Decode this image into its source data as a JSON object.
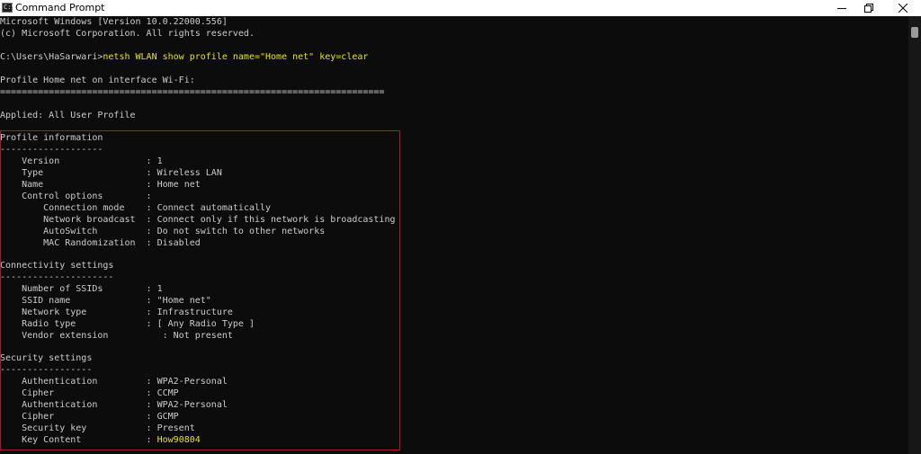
{
  "window": {
    "title": "Command Prompt",
    "app_icon": "C:\\",
    "icon_names": [
      "terminal-icon",
      "minimize-icon",
      "maximize-icon",
      "close-icon"
    ]
  },
  "colors": {
    "terminal_bg": "#0c0c0c",
    "terminal_text": "#cccccc",
    "highlight": "#e5e510",
    "box_border": "#b2162a"
  },
  "console": {
    "l1": "Microsoft Windows [Version 10.0.22000.556]",
    "l2": "(c) Microsoft Corporation. All rights reserved.",
    "prompt": "C:\\Users\\HaSarwari>",
    "command": "netsh WLAN show profile name=\"Home net\" key=clear",
    "l4": "Profile Home net on interface Wi-Fi:",
    "l5": "=======================================================================",
    "l6": "Applied: All User Profile",
    "profile": {
      "header": "Profile information",
      "underline": "-------------------",
      "rows": [
        "    Version                : 1",
        "    Type                   : Wireless LAN",
        "    Name                   : Home net",
        "    Control options        :",
        "        Connection mode    : Connect automatically",
        "        Network broadcast  : Connect only if this network is broadcasting",
        "        AutoSwitch         : Do not switch to other networks",
        "        MAC Randomization  : Disabled"
      ]
    },
    "connectivity": {
      "header": "Connectivity settings",
      "underline": "---------------------",
      "rows": [
        "    Number of SSIDs        : 1",
        "    SSID name              : \"Home net\"",
        "    Network type           : Infrastructure",
        "    Radio type             : [ Any Radio Type ]",
        "    Vendor extension          : Not present"
      ]
    },
    "security": {
      "header": "Security settings",
      "underline": "-----------------",
      "rows": [
        "    Authentication         : WPA2-Personal",
        "    Cipher                 : CCMP",
        "    Authentication         : WPA2-Personal",
        "    Cipher                 : GCMP",
        "    Security key           : Present"
      ],
      "key_label": "    Key Content            : ",
      "key_value": "How90804"
    }
  }
}
